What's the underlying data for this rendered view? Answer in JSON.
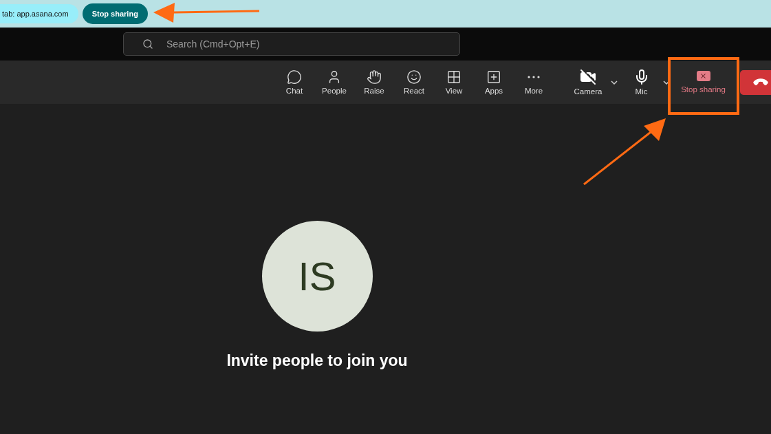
{
  "share_banner": {
    "tab_label": "tab: app.asana.com",
    "stop_button": "Stop sharing"
  },
  "search": {
    "placeholder": "Search (Cmd+Opt+E)"
  },
  "toolbar": {
    "items": [
      {
        "label": "Chat"
      },
      {
        "label": "People"
      },
      {
        "label": "Raise"
      },
      {
        "label": "React"
      },
      {
        "label": "View"
      },
      {
        "label": "Apps"
      },
      {
        "label": "More"
      }
    ],
    "camera": {
      "label": "Camera",
      "on": false
    },
    "mic": {
      "label": "Mic"
    },
    "stop_sharing": {
      "label": "Stop sharing"
    }
  },
  "stage": {
    "initials": "IS",
    "caption": "Invite people to join you"
  }
}
